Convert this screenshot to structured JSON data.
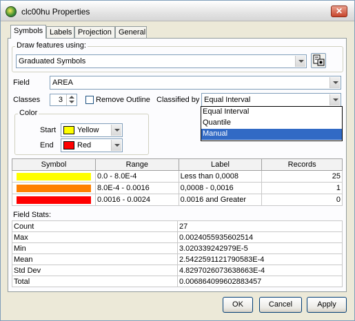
{
  "window": {
    "title": "clc00hu Properties",
    "close_label": "✕"
  },
  "tabs": [
    "Symbols",
    "Labels",
    "Projection",
    "General"
  ],
  "draw": {
    "group_label": "Draw features using:",
    "value": "Graduated Symbols"
  },
  "field": {
    "label": "Field",
    "value": "AREA"
  },
  "classes": {
    "label": "Classes",
    "value": "3"
  },
  "remove_outline": {
    "label": "Remove Outline",
    "checked": false
  },
  "classified_by": {
    "label": "Classified by",
    "value": "Equal Interval",
    "options": [
      "Equal Interval",
      "Quantile",
      "Manual"
    ],
    "highlighted": "Manual"
  },
  "color": {
    "group_label": "Color",
    "start_label": "Start",
    "start_value": "Yellow",
    "start_color": "#ffff00",
    "end_label": "End",
    "end_value": "Red",
    "end_color": "#ff0000"
  },
  "class_table": {
    "headers": [
      "Symbol",
      "Range",
      "Label",
      "Records"
    ],
    "rows": [
      {
        "color": "#ffff00",
        "range": "0.0 - 8.0E-4",
        "label": "Less than 0,0008",
        "records": "25"
      },
      {
        "color": "#ff8000",
        "range": "8.0E-4 - 0.0016",
        "label": "0,0008 - 0,0016",
        "records": "1"
      },
      {
        "color": "#ff0000",
        "range": "0.0016 - 0.0024",
        "label": "0.0016 and Greater",
        "records": "0"
      }
    ]
  },
  "field_stats": {
    "title": "Field Stats:",
    "rows": [
      {
        "name": "Count",
        "value": "27"
      },
      {
        "name": "Max",
        "value": "0.0024055935602514"
      },
      {
        "name": "Min",
        "value": "3.020339242979E-5"
      },
      {
        "name": "Mean",
        "value": "2.5422591121790583E-4"
      },
      {
        "name": "Std Dev",
        "value": "4.8297026073638663E-4"
      },
      {
        "name": "Total",
        "value": "0.006864099602883457"
      }
    ]
  },
  "buttons": {
    "ok": "OK",
    "cancel": "Cancel",
    "apply": "Apply"
  }
}
